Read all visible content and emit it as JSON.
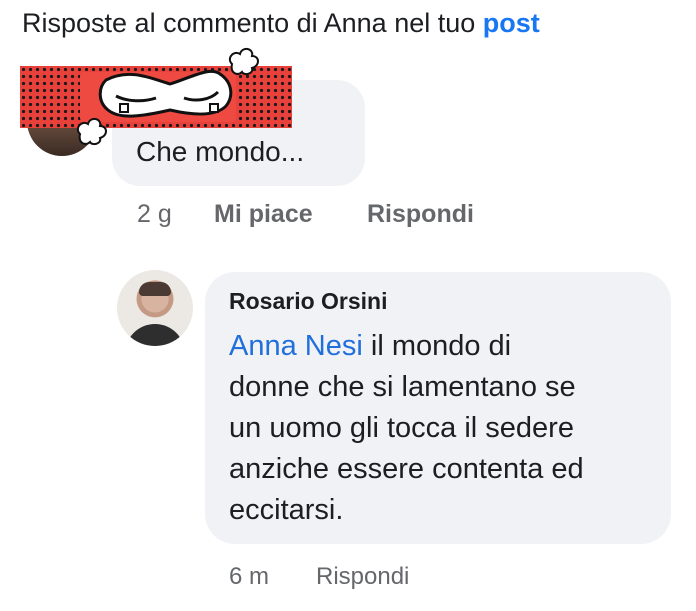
{
  "header": {
    "text": "Risposte al commento di Anna nel tuo",
    "post_link": "post"
  },
  "comment1": {
    "text": "Che mondo...",
    "sticker_icon": "cartoon-face-sticker-icon",
    "time": "2 g",
    "like_label": "Mi piace",
    "reply_label": "Rispondi"
  },
  "reply": {
    "author": "Rosario Orsini",
    "mention": "Anna Nesi",
    "text": " il mondo di\ndonne che si lamentano se\nun uomo gli tocca il sedere\nanziche essere contenta ed\neccitarsi.",
    "time": "6 m",
    "reply_label": "Rispondi"
  },
  "colors": {
    "link_blue": "#1877f2",
    "mention_blue": "#216fdb",
    "bubble_bg": "#f0f2f5",
    "meta_gray": "#65676b",
    "sticker_red": "#e8403a"
  }
}
